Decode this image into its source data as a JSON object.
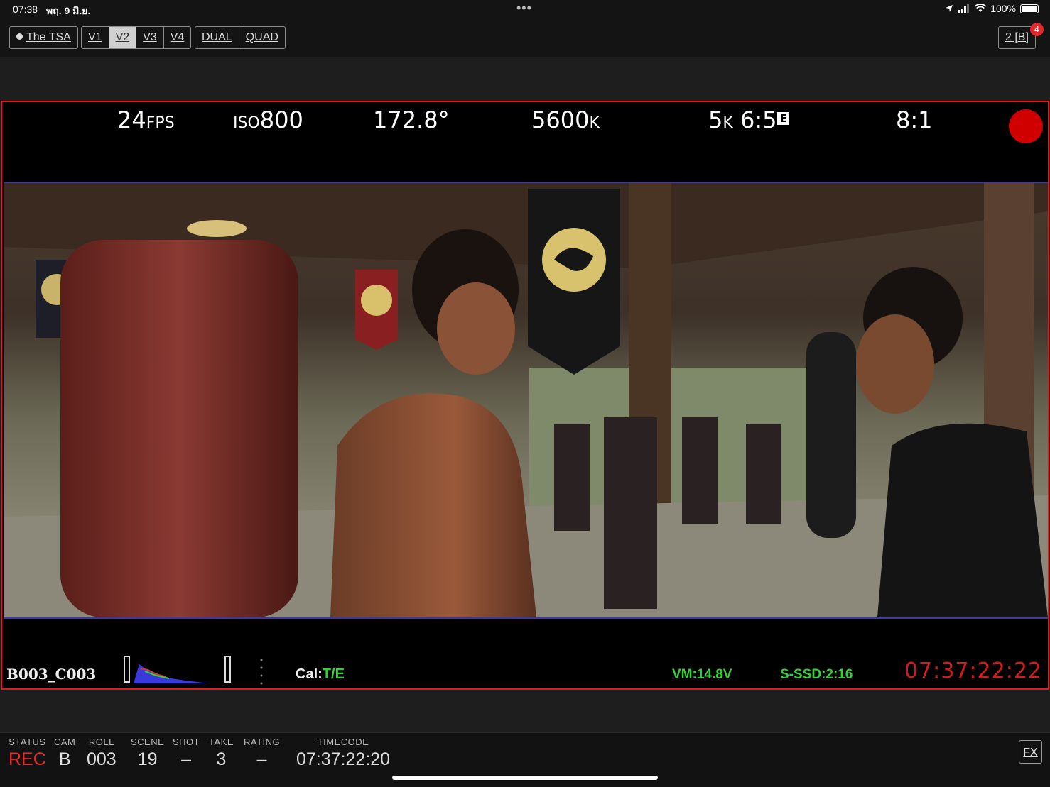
{
  "status_bar": {
    "time": "07:38",
    "date": "พฤ. 9 มิ.ย.",
    "dots": "•••",
    "battery": "100%",
    "location_icon": "location-arrow-icon",
    "signal_icon": "cellular-signal-icon",
    "wifi_icon": "wifi-icon"
  },
  "toolbar": {
    "project": "The TSA",
    "views": [
      "V1",
      "V2",
      "V3",
      "V4"
    ],
    "active_view": "V2",
    "layouts": [
      "DUAL",
      "QUAD"
    ],
    "camera_button": "2 [B]",
    "notification_count": "4"
  },
  "monitor": {
    "fps_value": "24",
    "fps_unit": "FPS",
    "iso_label": "ISO",
    "iso_value": "800",
    "shutter": "172.8°",
    "wb_value": "5600",
    "wb_unit": "K",
    "resolution_value": "5",
    "resolution_unit": "K",
    "aspect": "6:5",
    "aspect_badge": "E",
    "compression": "8:1",
    "record_color": "#d00000",
    "clip_name": "B003_C003",
    "cal_label": "Cal:",
    "cal_value": "T/E",
    "voltage": "VM:14.8V",
    "media": "S-SSD:2:16",
    "timecode": "07:37:22:22",
    "frame_border_color": "#e41b1b"
  },
  "info_bar": {
    "status_label": "STATUS",
    "status_value": "REC",
    "cam_label": "CAM",
    "cam_value": "B",
    "roll_label": "ROLL",
    "roll_value": "003",
    "scene_label": "SCENE",
    "scene_value": "19",
    "shot_label": "SHOT",
    "shot_value": "–",
    "take_label": "TAKE",
    "take_value": "3",
    "rating_label": "RATING",
    "rating_value": "–",
    "timecode_label": "TIMECODE",
    "timecode_value": "07:37:22:20",
    "fx_button": "FX"
  }
}
